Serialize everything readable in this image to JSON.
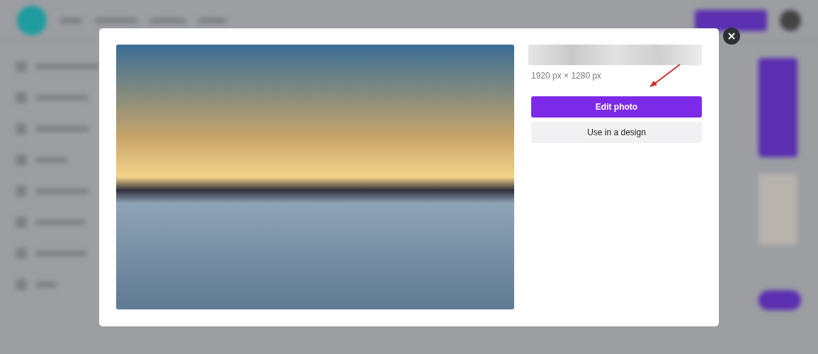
{
  "modal": {
    "image_size": "1920 px × 1280 px",
    "buttons": [
      {
        "label": "Edit photo",
        "kind": "primary"
      },
      {
        "label": "Use in a design",
        "kind": "secondary"
      }
    ]
  }
}
